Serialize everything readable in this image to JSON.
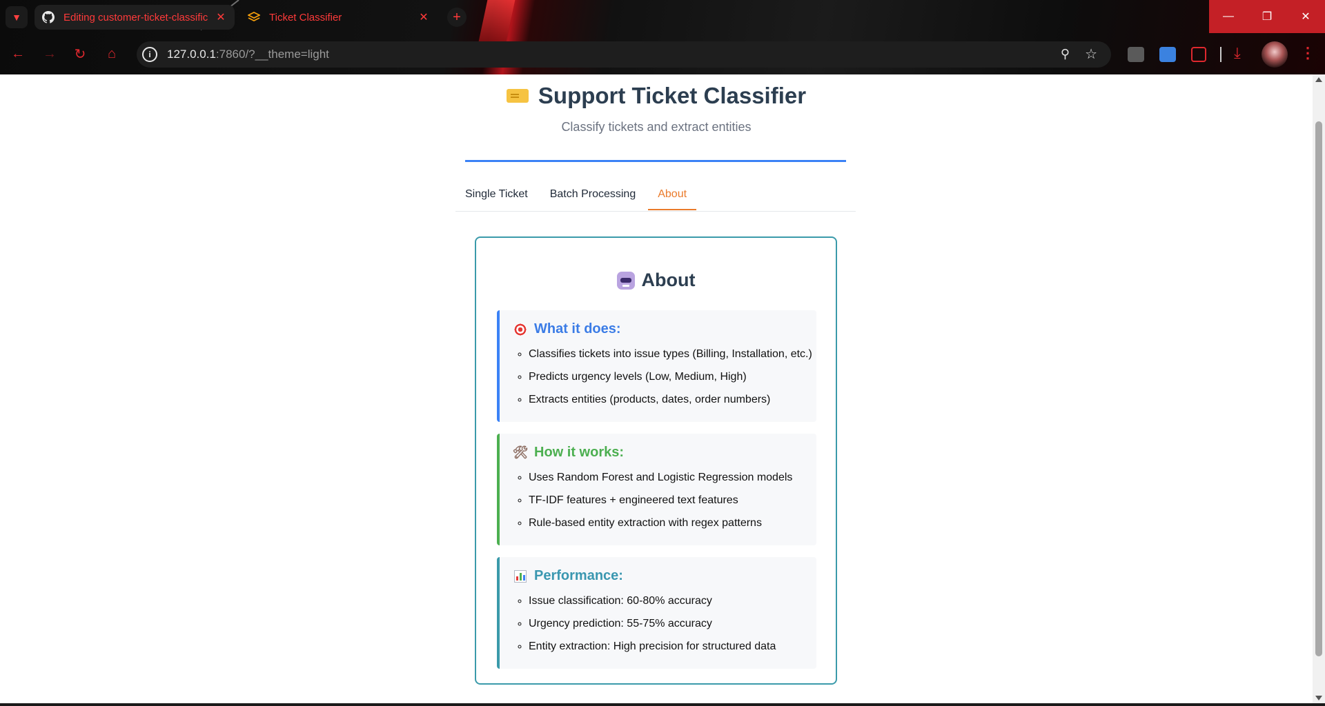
{
  "browser": {
    "tabs": [
      {
        "title": "Editing customer-ticket-classific",
        "icon": "github-icon"
      },
      {
        "title": "Ticket Classifier",
        "icon": "gradio-icon"
      }
    ],
    "url_host": "127.0.0.1",
    "url_rest": ":7860/?__theme=light"
  },
  "app": {
    "title": "Support Ticket Classifier",
    "subtitle": "Classify tickets and extract entities",
    "tabs": [
      "Single Ticket",
      "Batch Processing",
      "About"
    ],
    "active_tab": "About"
  },
  "about": {
    "heading": "About",
    "sections": [
      {
        "title": "What it does:",
        "icon": "target-icon",
        "items": [
          "Classifies tickets into issue types (Billing, Installation, etc.)",
          "Predicts urgency levels (Low, Medium, High)",
          "Extracts entities (products, dates, order numbers)"
        ]
      },
      {
        "title": "How it works:",
        "icon": "tools-icon",
        "items": [
          "Uses Random Forest and Logistic Regression models",
          "TF-IDF features + engineered text features",
          "Rule-based entity extraction with regex patterns"
        ]
      },
      {
        "title": "Performance:",
        "icon": "bar-chart-icon",
        "items": [
          "Issue classification: 60-80% accuracy",
          "Urgency prediction: 55-75% accuracy",
          "Entity extraction: High precision for structured data"
        ]
      }
    ]
  },
  "colors": {
    "accent_blue": "#3b82f6",
    "accent_green": "#4caf50",
    "accent_teal": "#3a9aaa",
    "active_tab": "#ea7a2a",
    "browser_red": "#e0282e"
  }
}
